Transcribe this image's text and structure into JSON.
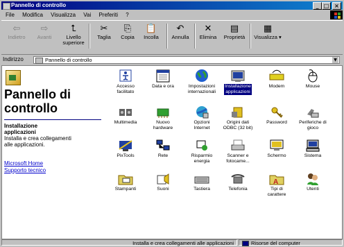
{
  "window": {
    "title": "Pannello di controllo"
  },
  "menu": [
    "File",
    "Modifica",
    "Visualizza",
    "Vai",
    "Preferiti",
    "?"
  ],
  "toolbar": {
    "back": "Indietro",
    "forward": "Avanti",
    "up_line1": "Livello",
    "up_line2": "superiore",
    "cut": "Taglia",
    "copy": "Copia",
    "paste": "Incolla",
    "undo": "Annulla",
    "delete": "Elimina",
    "properties": "Proprietà",
    "views": "Visualizza"
  },
  "address": {
    "label": "Indirizzo",
    "value": "Pannello di controllo"
  },
  "left_panel": {
    "title_line1": "Pannello di",
    "title_line2": "controllo",
    "selected_title_line1": "Installazione",
    "selected_title_line2": "applicazioni",
    "selected_desc_line1": "Installa e crea collegamenti",
    "selected_desc_line2": "alle applicazioni.",
    "link1": "Microsoft Home",
    "link2": "Supporto tecnico"
  },
  "items": [
    {
      "l1": "Accesso",
      "l2": "facilitato",
      "icon": "accessibility-icon"
    },
    {
      "l1": "Data e ora",
      "l2": "",
      "icon": "calendar-icon"
    },
    {
      "l1": "Impostazioni",
      "l2": "internazionali",
      "icon": "globe-icon"
    },
    {
      "l1": "Installazione",
      "l2": "applicazioni",
      "icon": "add-remove-programs-icon",
      "selected": true
    },
    {
      "l1": "Modem",
      "l2": "",
      "icon": "modem-icon"
    },
    {
      "l1": "Mouse",
      "l2": "",
      "icon": "mouse-icon"
    },
    {
      "l1": "Multimedia",
      "l2": "",
      "icon": "multimedia-icon"
    },
    {
      "l1": "Nuovo",
      "l2": "hardware",
      "icon": "add-hardware-icon"
    },
    {
      "l1": "Opzioni",
      "l2": "Internet",
      "icon": "internet-options-icon"
    },
    {
      "l1": "Origini dati",
      "l2": "ODBC (32 bit)",
      "icon": "odbc-icon"
    },
    {
      "l1": "Password",
      "l2": "",
      "icon": "password-icon"
    },
    {
      "l1": "Periferiche di",
      "l2": "gioco",
      "icon": "game-controller-icon"
    },
    {
      "l1": "PixTools",
      "l2": "",
      "icon": "pixtools-icon"
    },
    {
      "l1": "Rete",
      "l2": "",
      "icon": "network-icon"
    },
    {
      "l1": "Risparmio",
      "l2": "energia",
      "icon": "power-icon"
    },
    {
      "l1": "Scanner e",
      "l2": "fotocame...",
      "icon": "scanner-icon"
    },
    {
      "l1": "Schermo",
      "l2": "",
      "icon": "display-icon"
    },
    {
      "l1": "Sistema",
      "l2": "",
      "icon": "system-icon"
    },
    {
      "l1": "Stampanti",
      "l2": "",
      "icon": "printers-folder-icon"
    },
    {
      "l1": "Suoni",
      "l2": "",
      "icon": "sounds-icon"
    },
    {
      "l1": "Tastiera",
      "l2": "",
      "icon": "keyboard-icon"
    },
    {
      "l1": "Telefonia",
      "l2": "",
      "icon": "telephony-icon"
    },
    {
      "l1": "Tipi di",
      "l2": "carattere",
      "icon": "fonts-folder-icon"
    },
    {
      "l1": "Utenti",
      "l2": "",
      "icon": "users-icon"
    }
  ],
  "status": {
    "message": "Installa e crea collegamenti alle applicazioni",
    "zone": "Risorse del computer"
  }
}
